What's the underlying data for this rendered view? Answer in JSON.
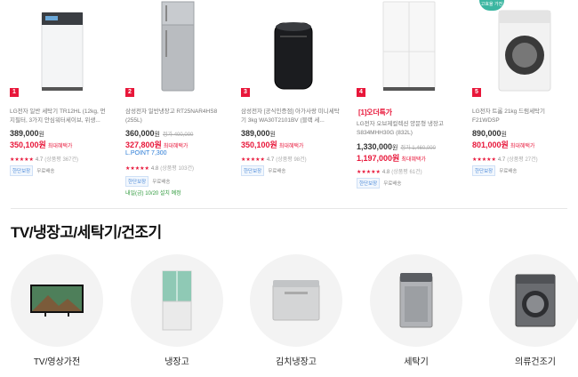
{
  "products": [
    {
      "rank": "1",
      "image": "top-load-washer-white",
      "name": "LG전자 일반 세탁기 TR12HL (12kg, 먼지필터, 3가지 안심워터세이브, 위생...",
      "original_price": "389,000",
      "sale_price": "350,100",
      "sale_tag": "최대혜택가",
      "stars": "★★★★★",
      "rating": "4.7",
      "reviews": "(상품평 367건)",
      "tags": [
        "한단보장",
        "무료배송"
      ]
    },
    {
      "rank": "2",
      "image": "refrigerator-silver",
      "name": "삼성전자 일반냉장고 RT25NAR4HS8 (255L)",
      "original_price": "360,000",
      "before_price": "정가 400,000",
      "sale_price": "327,800",
      "sale_tag": "최대혜택가",
      "lpoint": "L.POINT 7,300",
      "stars": "★★★★★",
      "rating": "4.8",
      "reviews": "(상품평 103건)",
      "tags": [
        "한단보장",
        "무료배송"
      ],
      "delivery": "내일(금) 10/20 설치 예정"
    },
    {
      "rank": "3",
      "image": "mini-washer-black",
      "name": "삼성전자 [공식인증점] 아가사랑 미니세탁기 3kg WA30T2101BV (블랙 세...",
      "original_price": "389,000",
      "sale_price": "350,100",
      "sale_tag": "최대혜택가",
      "stars": "★★★★★",
      "rating": "4.7",
      "reviews": "(상품평 98건)",
      "tags": [
        "한단보장",
        "무료배송"
      ]
    },
    {
      "rank": "4",
      "image": "fridge-white-4door",
      "promo": "[1]오더특가",
      "name": "LG전자 오브제컬렉션 양문형 냉장고 S834MHH30G (832L)",
      "original_price": "1,330,000",
      "before_price": "정가 1,460,000",
      "sale_price": "1,197,000",
      "sale_tag": "최대혜택가",
      "stars": "★★★★★",
      "rating": "4.8",
      "reviews": "(상품평 61건)",
      "tags": [
        "한단보장",
        "무료배송"
      ]
    },
    {
      "rank": "5",
      "image": "front-load-washer-white",
      "badge": "고효율 가전",
      "name": "LG전자 트롬 21kg 드럼세탁기 F21WDSP",
      "original_price": "890,000",
      "sale_price": "801,000",
      "sale_tag": "최대혜택가",
      "stars": "★★★★★",
      "rating": "4.7",
      "reviews": "(상품평 27건)",
      "tags": [
        "한단보장",
        "무료배송"
      ]
    }
  ],
  "currency": "원",
  "section": {
    "title": "TV/냉장고/세탁기/건조기"
  },
  "categories": [
    {
      "label": "TV/영상가전",
      "icon": "tv-icon"
    },
    {
      "label": "냉장고",
      "icon": "refrigerator-icon"
    },
    {
      "label": "김치냉장고",
      "icon": "kimchi-fridge-icon"
    },
    {
      "label": "세탁기",
      "icon": "washing-machine-icon"
    },
    {
      "label": "의류건조기",
      "icon": "dryer-icon"
    }
  ],
  "colors": {
    "accent": "#e8173a",
    "link": "#2a7bd6",
    "delivery": "#2f9a3c"
  }
}
